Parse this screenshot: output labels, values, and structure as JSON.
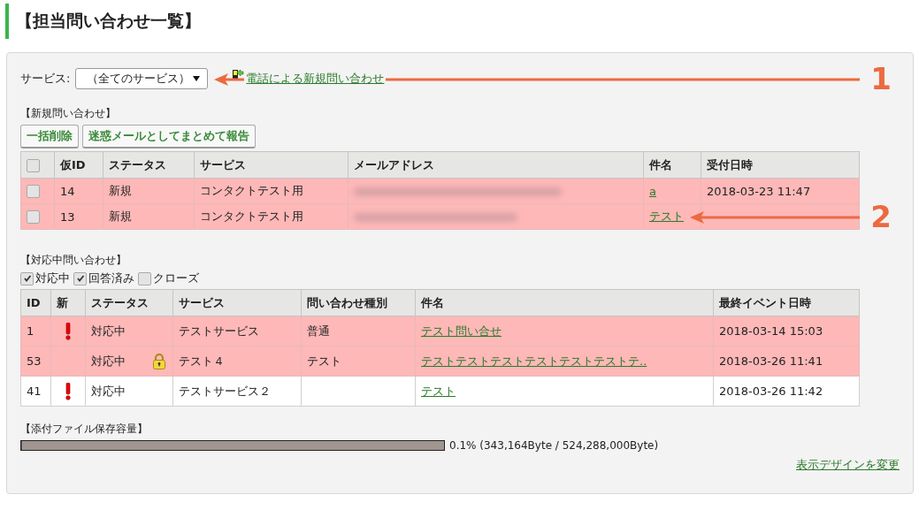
{
  "page_title": "【担当問い合わせ一覧】",
  "filter": {
    "label": "サービス:",
    "value": "（全てのサービス）",
    "link": "電話による新規問い合わせ"
  },
  "new_inquiries": {
    "heading": "【新規問い合わせ】",
    "buttons": [
      "一括削除",
      "迷惑メールとしてまとめて報告"
    ],
    "columns": [
      "",
      "仮ID",
      "ステータス",
      "サービス",
      "メールアドレス",
      "件名",
      "受付日時"
    ],
    "header_checked": false,
    "rows": [
      {
        "checked": false,
        "highlighted": true,
        "id": "14",
        "status": "新規",
        "service": "コンタクトテスト用",
        "email_blurred": true,
        "subject": "a",
        "received": "2018-03-23 11:47"
      },
      {
        "checked": false,
        "highlighted": true,
        "id": "13",
        "status": "新規",
        "service": "コンタクトテスト用",
        "email_blurred": true,
        "subject": "テスト"
      }
    ]
  },
  "active_inquiries": {
    "heading": "【対応中問い合わせ】",
    "filters": [
      {
        "label": "対応中",
        "checked": true
      },
      {
        "label": "回答済み",
        "checked": true
      },
      {
        "label": "クローズ",
        "checked": false
      }
    ],
    "columns": [
      "ID",
      "新",
      "ステータス",
      "サービス",
      "問い合わせ種別",
      "件名",
      "最終イベント日時"
    ],
    "rows": [
      {
        "highlighted": true,
        "id": "1",
        "new": true,
        "status": "対応中",
        "locked": false,
        "service": "テストサービス",
        "type": "普通",
        "subject": "テスト問い合せ",
        "last_event": "2018-03-14 15:03"
      },
      {
        "highlighted": true,
        "id": "53",
        "new": false,
        "status": "対応中",
        "locked": true,
        "service": "テスト４",
        "type": "テスト",
        "subject": "テストテストテストテストテストテストテ..",
        "last_event": "2018-03-26 11:41"
      },
      {
        "highlighted": false,
        "id": "41",
        "new": true,
        "status": "対応中",
        "locked": false,
        "service": "テストサービス２",
        "subject": "テスト",
        "last_event": "2018-03-26 11:42"
      }
    ]
  },
  "storage": {
    "heading": "【添付ファイル保存容量】",
    "level": 0.001,
    "reading": "0.1% (343,164Byte / 524,288,000Byte)"
  },
  "design_link": "表示デザインを変更",
  "annotations": [
    {
      "label": "1"
    },
    {
      "label": "2"
    }
  ]
}
